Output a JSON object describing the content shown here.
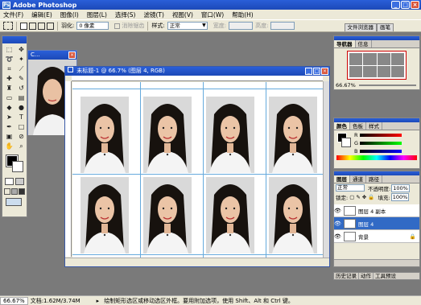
{
  "window": {
    "title": "Adobe Photoshop",
    "app_icon": "Ps"
  },
  "menu": [
    "文件(F)",
    "编辑(E)",
    "图像(I)",
    "图层(L)",
    "选择(S)",
    "滤镜(T)",
    "视图(V)",
    "窗口(W)",
    "帮助(H)"
  ],
  "options": {
    "feather_label": "羽化:",
    "feather_value": "0 像素",
    "antialias_label": "消除锯齿",
    "style_label": "样式:",
    "style_value": "正常",
    "width_label": "宽度:",
    "height_label": "高度:"
  },
  "top_tabs": [
    "文件浏览器",
    "画笔"
  ],
  "small_doc": {
    "title": "C..."
  },
  "main_doc": {
    "title": "未标题-1 @ 66.7% (图层 4, RGB)"
  },
  "navigator": {
    "tabs": [
      "导航器",
      "信息"
    ],
    "zoom": "66.67%"
  },
  "color_panel": {
    "tabs": [
      "颜色",
      "色板",
      "样式"
    ],
    "channels": [
      "R",
      "G",
      "B"
    ]
  },
  "layers_panel": {
    "tabs": [
      "图层",
      "通道",
      "路径"
    ],
    "blend_mode": "正常",
    "opacity_label": "不透明度:",
    "opacity_value": "100%",
    "lock_label": "锁定:",
    "fill_label": "填充:",
    "fill_value": "100%",
    "layers": [
      {
        "name": "图层 4 副本",
        "selected": false
      },
      {
        "name": "图层 4",
        "selected": true
      },
      {
        "name": "背景",
        "selected": false
      }
    ]
  },
  "history_tabs": [
    "历史记录",
    "动作",
    "工具预设"
  ],
  "status": {
    "zoom": "66.67%",
    "doc": "文档:1.62M/3.74M",
    "hint": "绘制矩形选区或移动选区外框。要用附加选项，使用 Shift、Alt 和 Ctrl 键。"
  },
  "colors": {
    "title_blue": "#1c49b8",
    "panel_bg": "#ece9d8",
    "workspace": "#7a7a7a",
    "selection": "#316ac5"
  }
}
